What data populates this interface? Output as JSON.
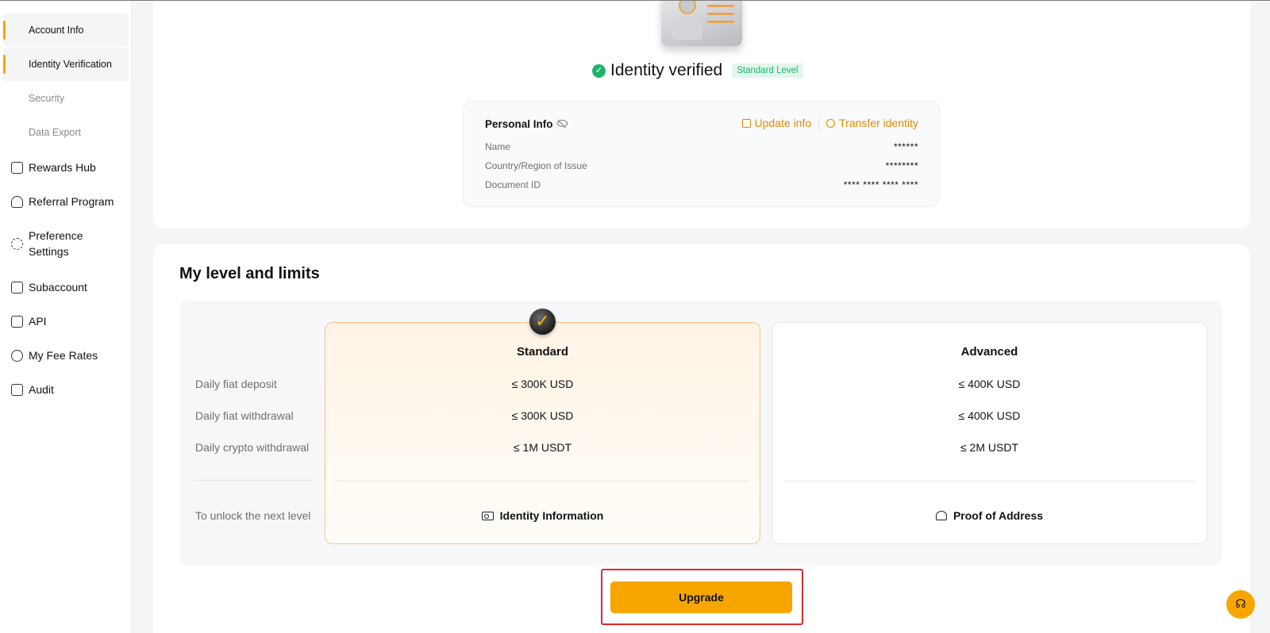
{
  "sidebar": {
    "sub_items": [
      {
        "label": "Account Info"
      },
      {
        "label": "Identity Verification"
      },
      {
        "label": "Security"
      },
      {
        "label": "Data Export"
      }
    ],
    "items": [
      {
        "label": "Rewards Hub",
        "icon": "gift-icon"
      },
      {
        "label": "Referral Program",
        "icon": "referral-icon"
      },
      {
        "label": "Preference Settings",
        "icon": "gear-icon"
      },
      {
        "label": "Subaccount",
        "icon": "subaccount-icon"
      },
      {
        "label": "API",
        "icon": "api-icon"
      },
      {
        "label": "My Fee Rates",
        "icon": "fee-icon"
      },
      {
        "label": "Audit",
        "icon": "audit-icon"
      }
    ]
  },
  "verification": {
    "title": "Identity verified",
    "badge": "Standard Level",
    "check_glyph": "✓"
  },
  "personal_info": {
    "title": "Personal Info",
    "update_label": "Update info",
    "transfer_label": "Transfer identity",
    "rows": [
      {
        "label": "Name",
        "value": "******"
      },
      {
        "label": "Country/Region of Issue",
        "value": "********"
      },
      {
        "label": "Document ID",
        "value": "**** **** **** ****"
      }
    ]
  },
  "limits": {
    "title": "My level and limits",
    "row_labels": [
      "Daily fiat deposit",
      "Daily fiat withdrawal",
      "Daily crypto withdrawal"
    ],
    "unlock_label": "To unlock the next level",
    "levels": [
      {
        "name": "Standard",
        "values": [
          "≤ 300K USD",
          "≤ 300K USD",
          "≤ 1M USDT"
        ],
        "unlock": "Identity Information",
        "current": true
      },
      {
        "name": "Advanced",
        "values": [
          "≤ 400K USD",
          "≤ 400K USD",
          "≤ 2M USDT"
        ],
        "unlock": "Proof of Address",
        "current": false
      }
    ],
    "upgrade_label": "Upgrade"
  },
  "colors": {
    "accent": "#f7a600",
    "link": "#e68a00",
    "success": "#20b26c",
    "highlight_outline": "#e0282e"
  }
}
